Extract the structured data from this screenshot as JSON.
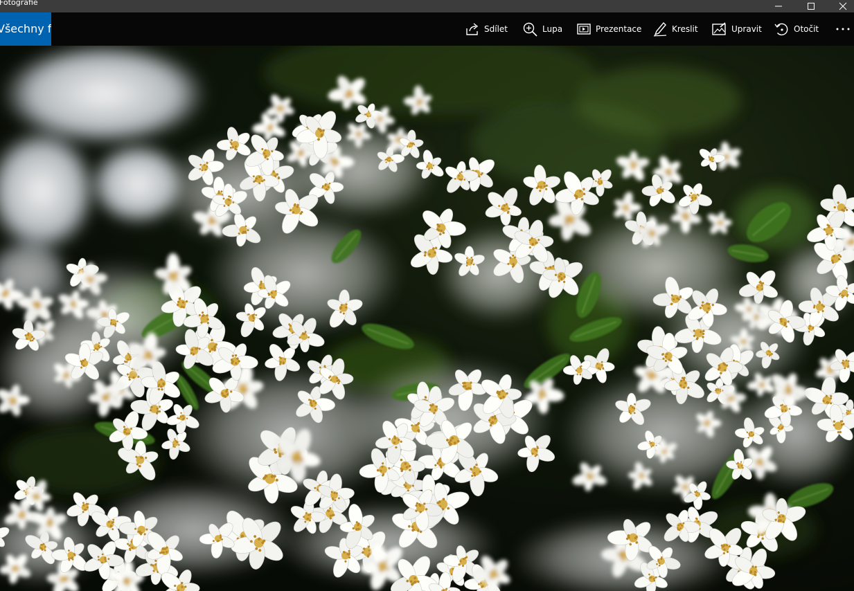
{
  "window": {
    "title": "Fotografie"
  },
  "toolbar": {
    "back_label": "Všechny fotky",
    "share_label": "Sdílet",
    "zoom_label": "Lupa",
    "slideshow_label": "Prezentace",
    "draw_label": "Kreslit",
    "edit_label": "Upravit",
    "rotate_label": "Otočit"
  },
  "icons": {
    "minimize": "minimize-icon",
    "maximize": "maximize-icon",
    "close": "close-icon",
    "share": "share-icon",
    "zoom": "magnifier-icon",
    "slideshow": "slideshow-icon",
    "draw": "pen-icon",
    "edit": "edit-photo-icon",
    "rotate": "rotate-icon",
    "more": "more-dots-icon"
  },
  "colors": {
    "accent": "#0063b1",
    "toolbar_bg": "#070707",
    "titlebar_bg": "#3c3c3c"
  }
}
